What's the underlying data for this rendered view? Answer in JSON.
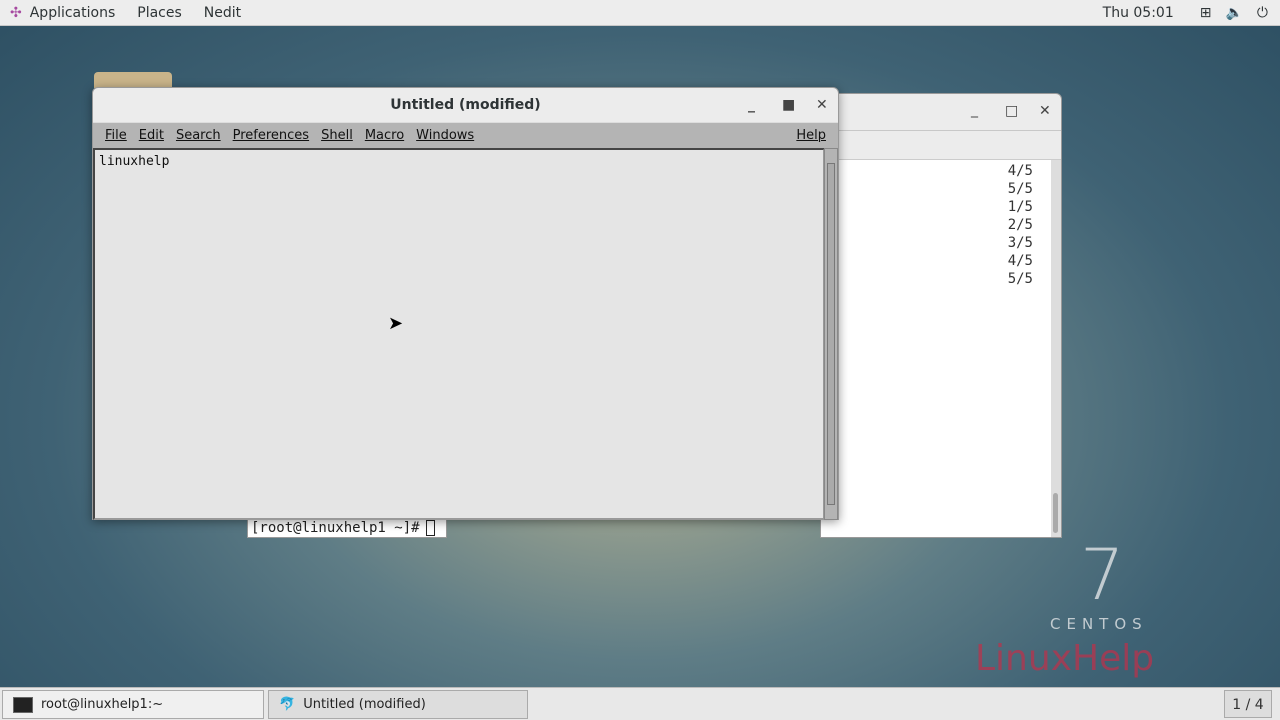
{
  "topbar": {
    "applications": "Applications",
    "places": "Places",
    "app": "Nedit",
    "clock": "Thu 05:01"
  },
  "terminal": {
    "lines": [
      "4/5",
      "5/5",
      "1/5",
      "2/5",
      "3/5",
      "4/5",
      "5/5"
    ],
    "prompt": "[root@linuxhelp1 ~]#"
  },
  "nedit": {
    "title": "Untitled (modified)",
    "menu": [
      "File",
      "Edit",
      "Search",
      "Preferences",
      "Shell",
      "Macro",
      "Windows"
    ],
    "help": "Help",
    "text": "linuxhelp"
  },
  "taskbar": {
    "items": [
      "root@linuxhelp1:~",
      "Untitled (modified)"
    ],
    "pager": "1 / 4"
  },
  "desktop": {
    "logo_number": "7",
    "logo_text": "CENTOS",
    "watermark": "LinuxHelp"
  }
}
